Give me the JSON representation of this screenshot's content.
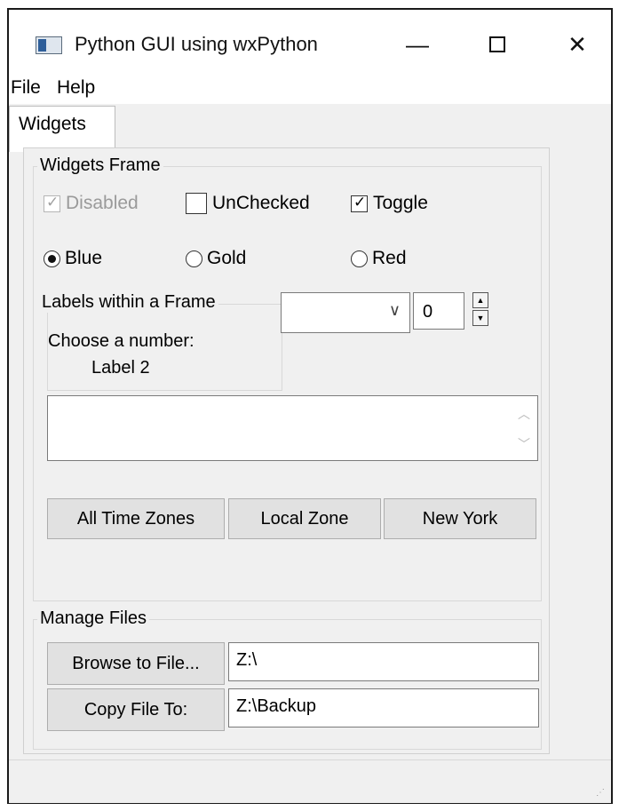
{
  "window": {
    "title": "Python GUI using wxPython",
    "minimize_icon": "minimize-icon",
    "maximize_icon": "maximize-icon",
    "close_icon": "close-icon"
  },
  "menu": [
    "File",
    "Help"
  ],
  "tab": "Widgets",
  "widgets_frame": {
    "label": "Widgets Frame",
    "checkboxes": [
      {
        "label": "Disabled",
        "checked": true,
        "disabled": true
      },
      {
        "label": "UnChecked",
        "checked": false,
        "disabled": false
      },
      {
        "label": "Toggle",
        "checked": true,
        "disabled": false
      }
    ],
    "radios": [
      {
        "label": "Blue",
        "selected": true
      },
      {
        "label": "Gold",
        "selected": false
      },
      {
        "label": "Red",
        "selected": false
      }
    ],
    "labels_frame": {
      "label": "Labels within a Frame",
      "line1": "Choose a number:",
      "line2": "Label 2"
    },
    "combo_value": "",
    "spin_value": "0",
    "text_area": "",
    "buttons": [
      "All Time Zones",
      "Local Zone",
      "New York"
    ]
  },
  "manage_files": {
    "label": "Manage Files",
    "browse_label": "Browse to File...",
    "browse_value": "Z:\\",
    "copy_label": "Copy File To:",
    "copy_value": "Z:\\Backup"
  },
  "colors": {
    "window_bg": "#f0f0f0",
    "button_bg": "#e1e1e1"
  }
}
